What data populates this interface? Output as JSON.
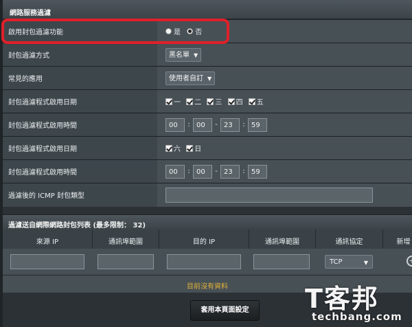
{
  "section_title": "網路服務過濾",
  "rows": [
    {
      "label": "啟用封包過濾功能",
      "radio_yes": "是",
      "radio_no": "否"
    },
    {
      "label": "封包過濾方式",
      "select": "黑名單"
    },
    {
      "label": "常見的應用",
      "select": "使用者自訂"
    },
    {
      "label": "封包過濾程式啟用日期",
      "days": [
        "一",
        "二",
        "三",
        "四",
        "五"
      ]
    },
    {
      "label": "封包過濾程式啟用時間",
      "times": [
        "00",
        "00",
        "23",
        "59"
      ]
    },
    {
      "label": "封包過濾程式啟用日期",
      "days": [
        "六",
        "日"
      ]
    },
    {
      "label": "封包過濾程式啟用時間",
      "times": [
        "00",
        "00",
        "23",
        "59"
      ]
    },
    {
      "label": "過濾後的 ICMP 封包類型"
    }
  ],
  "list_title": "過濾送自網際網路封包列表 (最多限制： 32)",
  "columns": [
    "來源 IP",
    "通訊埠範圍",
    "目的 IP",
    "通訊埠範圍",
    "通訊協定",
    "新增"
  ],
  "protocol_select": "TCP",
  "empty_text": "目前沒有資料",
  "apply_button": "套用本頁面設定",
  "watermark": {
    "text": "T客邦",
    "url": "techbang.com"
  },
  "colors": {
    "highlight": "#e0202a",
    "empty_text": "#e0b23b"
  }
}
